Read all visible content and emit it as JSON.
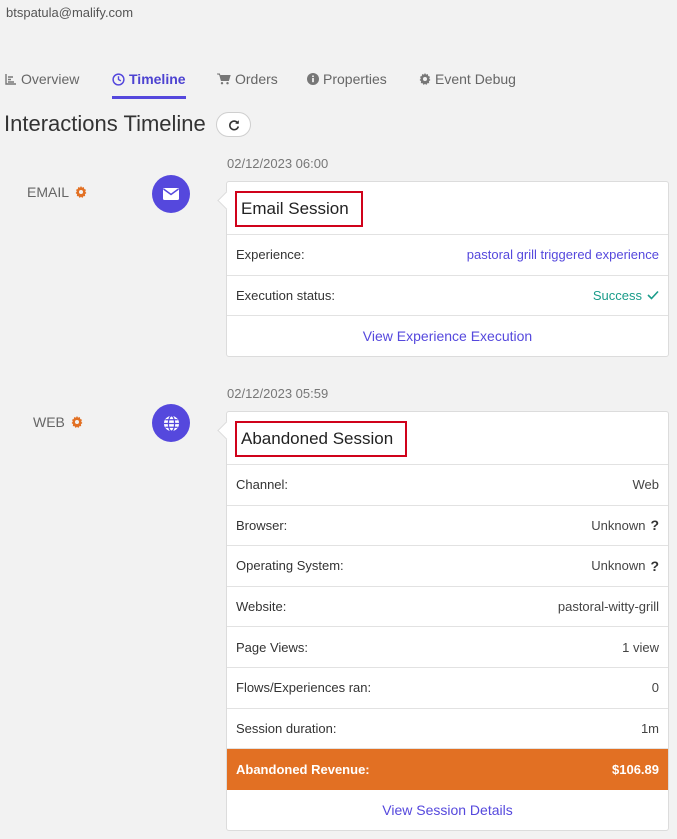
{
  "user": {
    "email": "btspatula@malify.com"
  },
  "tabs": [
    {
      "label": "Overview",
      "icon": "chart-icon",
      "active": false
    },
    {
      "label": "Timeline",
      "icon": "clock-icon",
      "active": true
    },
    {
      "label": "Orders",
      "icon": "cart-icon",
      "active": false
    },
    {
      "label": "Properties",
      "icon": "info-icon",
      "active": false
    },
    {
      "label": "Event Debug",
      "icon": "gear-icon",
      "active": false
    }
  ],
  "page_title": "Interactions Timeline",
  "colors": {
    "accent": "#5548dd",
    "channel_gear": "#e27023",
    "revenue_bg": "#e27023",
    "success": "#1a9c8a",
    "highlight_border": "#d0021b"
  },
  "events": [
    {
      "timestamp": "02/12/2023 06:00",
      "channel": "EMAIL",
      "channel_icon": "envelope-icon",
      "title": "Email Session",
      "rows": [
        {
          "label": "Experience:",
          "value": "pastoral grill triggered experience"
        },
        {
          "label": "Execution status:",
          "value": "Success"
        }
      ],
      "footer_link": "View Experience Execution"
    },
    {
      "timestamp": "02/12/2023 05:59",
      "channel": "WEB",
      "channel_icon": "globe-icon",
      "title": "Abandoned Session",
      "rows": [
        {
          "label": "Channel:",
          "value": "Web"
        },
        {
          "label": "Browser:",
          "value": "Unknown"
        },
        {
          "label": "Operating System:",
          "value": "Unknown"
        },
        {
          "label": "Website:",
          "value": "pastoral-witty-grill"
        },
        {
          "label": "Page Views:",
          "value": "1 view"
        },
        {
          "label": "Flows/Experiences ran:",
          "value": "0"
        },
        {
          "label": "Session duration:",
          "value": "1m"
        }
      ],
      "revenue": {
        "label": "Abandoned Revenue:",
        "value": "$106.89"
      },
      "footer_link": "View Session Details"
    }
  ]
}
